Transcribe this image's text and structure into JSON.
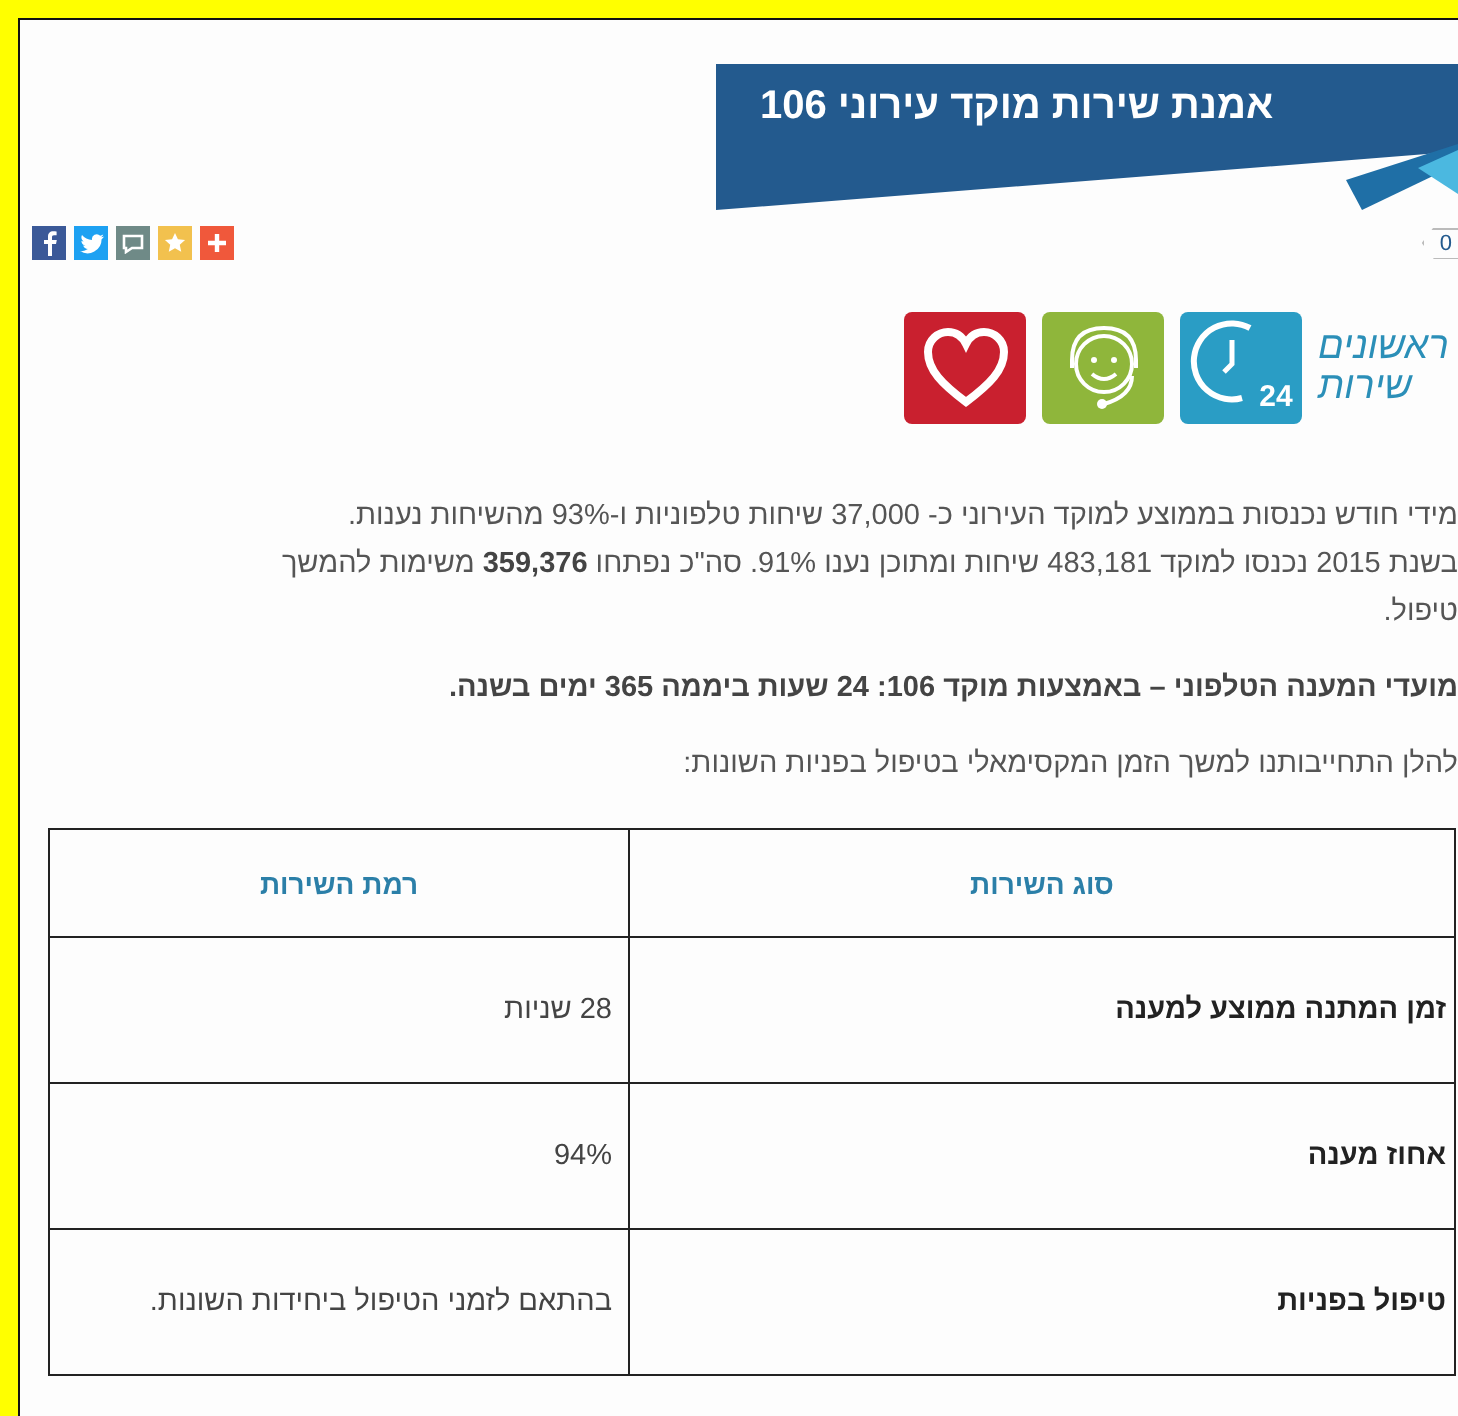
{
  "title": "אמנת שירות מוקד עירוני 106",
  "share_count": "0",
  "logo": {
    "line_1": "ראשונים",
    "line_2": "שירות"
  },
  "logo_icons": [
    {
      "kind": "heart"
    },
    {
      "kind": "agent"
    },
    {
      "kind": "clock",
      "label": "24"
    }
  ],
  "share_buttons": [
    {
      "kind": "facebook"
    },
    {
      "kind": "twitter"
    },
    {
      "kind": "message"
    },
    {
      "kind": "favorite"
    },
    {
      "kind": "more"
    }
  ],
  "paragraph_lines": [
    "מידי חודש נכנסות בממוצע למוקד העירוני כ- 37,000 שיחות טלפוניות ו-93% מהשיחות נענות.",
    "בשנת 2015 נכנסו למוקד 483,181 שיחות  ומתוכן נענו 91%.  סה\"כ נפתחו **359,376** משימות להמשך",
    "טיפול."
  ],
  "hours_line": "מועדי המענה הטלפוני – באמצעות מוקד 106: 24 שעות ביממה 365 ימים בשנה.",
  "intro_line": "להלן התחייבותנו למשך הזמן המקסימאלי בטיפול בפניות השונות:",
  "table": {
    "columns": [
      "סוג השירות",
      "רמת השירות"
    ],
    "rows": [
      {
        "service": "זמן המתנה ממוצע למענה",
        "level": "28 שניות"
      },
      {
        "service": "אחוז מענה",
        "level": "94%"
      },
      {
        "service": "טיפול בפניות",
        "level": "בהתאם לזמני הטיפול ביחידות השונות."
      }
    ]
  }
}
